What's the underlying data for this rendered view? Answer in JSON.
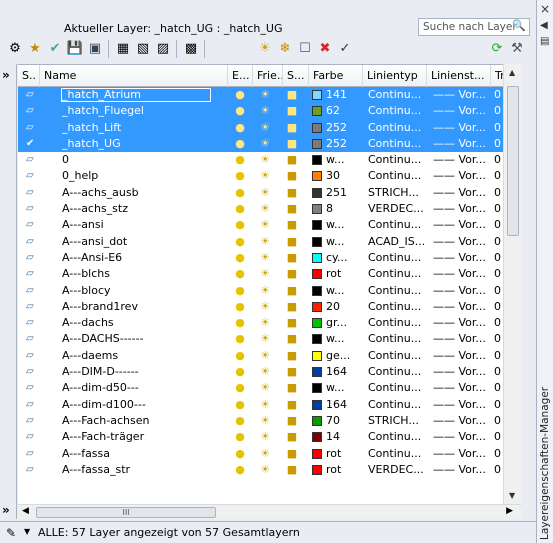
{
  "header": {
    "current_layer": "Aktueller Layer: _hatch_UG : _hatch_UG",
    "search_placeholder": "Suche nach Layer"
  },
  "columns": [
    "S..",
    "Name",
    "E...",
    "Frie...",
    "S...",
    "Farbe",
    "Linientyp",
    "Linienst...",
    "Trar"
  ],
  "rows": [
    {
      "name": "_hatch_Atrium",
      "color_hex": "#7fd8ff",
      "color": "141",
      "ltype": "Continu...",
      "lw": "Vor...",
      "tr": "0",
      "sel": true,
      "cur": false
    },
    {
      "name": "_hatch_Fluegel",
      "color_hex": "#6fa020",
      "color": "62",
      "ltype": "Continu...",
      "lw": "Vor...",
      "tr": "0",
      "sel": true,
      "cur": false
    },
    {
      "name": "_hatch_Lift",
      "color_hex": "#7a7a7a",
      "color": "252",
      "ltype": "Continu...",
      "lw": "Vor...",
      "tr": "0",
      "sel": true,
      "cur": false
    },
    {
      "name": "_hatch_UG",
      "color_hex": "#7a7a7a",
      "color": "252",
      "ltype": "Continu...",
      "lw": "Vor...",
      "tr": "0",
      "sel": true,
      "cur": true
    },
    {
      "name": "0",
      "color_hex": "#000000",
      "color": "w...",
      "ltype": "Continu...",
      "lw": "Vor...",
      "tr": "0",
      "sel": false,
      "cur": false
    },
    {
      "name": "0_help",
      "color_hex": "#ff8000",
      "color": "30",
      "ltype": "Continu...",
      "lw": "Vor...",
      "tr": "0",
      "sel": false,
      "cur": false
    },
    {
      "name": "A---achs_ausb",
      "color_hex": "#333333",
      "color": "251",
      "ltype": "STRICH...",
      "lw": "Vor...",
      "tr": "0",
      "sel": false,
      "cur": false
    },
    {
      "name": "A---achs_stz",
      "color_hex": "#808080",
      "color": "8",
      "ltype": "VERDEC...",
      "lw": "Vor...",
      "tr": "0",
      "sel": false,
      "cur": false
    },
    {
      "name": "A---ansi",
      "color_hex": "#000000",
      "color": "w...",
      "ltype": "Continu...",
      "lw": "Vor...",
      "tr": "0",
      "sel": false,
      "cur": false
    },
    {
      "name": "A---ansi_dot",
      "color_hex": "#000000",
      "color": "w...",
      "ltype": "ACAD_IS...",
      "lw": "Vor...",
      "tr": "0",
      "sel": false,
      "cur": false
    },
    {
      "name": "A---Ansi-E6",
      "color_hex": "#00ffff",
      "color": "cy...",
      "ltype": "Continu...",
      "lw": "Vor...",
      "tr": "0",
      "sel": false,
      "cur": false
    },
    {
      "name": "A---blchs",
      "color_hex": "#ff0000",
      "color": "rot",
      "ltype": "Continu...",
      "lw": "Vor...",
      "tr": "0",
      "sel": false,
      "cur": false
    },
    {
      "name": "A---blocy",
      "color_hex": "#000000",
      "color": "w...",
      "ltype": "Continu...",
      "lw": "Vor...",
      "tr": "0",
      "sel": false,
      "cur": false
    },
    {
      "name": "A---brand1rev",
      "color_hex": "#ff2000",
      "color": "20",
      "ltype": "Continu...",
      "lw": "Vor...",
      "tr": "0",
      "sel": false,
      "cur": false
    },
    {
      "name": "A---dachs",
      "color_hex": "#00c000",
      "color": "gr...",
      "ltype": "Continu...",
      "lw": "Vor...",
      "tr": "0",
      "sel": false,
      "cur": false
    },
    {
      "name": "A---DACHS------",
      "color_hex": "#000000",
      "color": "w...",
      "ltype": "Continu...",
      "lw": "Vor...",
      "tr": "0",
      "sel": false,
      "cur": false
    },
    {
      "name": "A---daems",
      "color_hex": "#ffff00",
      "color": "ge...",
      "ltype": "Continu...",
      "lw": "Vor...",
      "tr": "0",
      "sel": false,
      "cur": false
    },
    {
      "name": "A---DIM-D------",
      "color_hex": "#0040a0",
      "color": "164",
      "ltype": "Continu...",
      "lw": "Vor...",
      "tr": "0",
      "sel": false,
      "cur": false
    },
    {
      "name": "A---dim-d50---",
      "color_hex": "#000000",
      "color": "w...",
      "ltype": "Continu...",
      "lw": "Vor...",
      "tr": "0",
      "sel": false,
      "cur": false
    },
    {
      "name": "A---dim-d100---",
      "color_hex": "#0040a0",
      "color": "164",
      "ltype": "Continu...",
      "lw": "Vor...",
      "tr": "0",
      "sel": false,
      "cur": false
    },
    {
      "name": "A---Fach-achsen",
      "color_hex": "#00a000",
      "color": "70",
      "ltype": "STRICH...",
      "lw": "Vor...",
      "tr": "0",
      "sel": false,
      "cur": false
    },
    {
      "name": "A---Fach-träger",
      "color_hex": "#800000",
      "color": "14",
      "ltype": "Continu...",
      "lw": "Vor...",
      "tr": "0",
      "sel": false,
      "cur": false
    },
    {
      "name": "A---fassa",
      "color_hex": "#ff0000",
      "color": "rot",
      "ltype": "Continu...",
      "lw": "Vor...",
      "tr": "0",
      "sel": false,
      "cur": false
    },
    {
      "name": "A---fassa_str",
      "color_hex": "#ff0000",
      "color": "rot",
      "ltype": "VERDEC...",
      "lw": "Vor...",
      "tr": "0",
      "sel": false,
      "cur": false
    }
  ],
  "status": {
    "text": "ALLE: 57 Layer angezeigt von 57 Gesamtlayern"
  },
  "side": {
    "title": "Layereigenschaften-Manager"
  },
  "glyphs": {
    "lw_dash": "——",
    "hscroll_grip": "III",
    "collapse": "»",
    "close": "×"
  }
}
